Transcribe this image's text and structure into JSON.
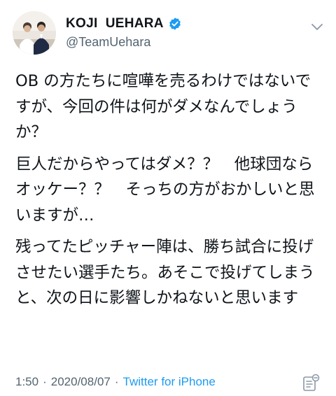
{
  "tweet": {
    "author": {
      "display_name": "KOJI  UEHARA",
      "handle": "@TeamUehara",
      "verified": true
    },
    "paragraphs": [
      "OB の方たちに喧嘩を売るわけではないですが、今回の件は何がダメなんでしょうか？",
      "巨人だからやってはダメ？？　他球団ならオッケー？？　そっちの方がおかしいと思いますが…",
      "残ってたピッチャー陣は、勝ち試合に投げさせたい選手たち。あそこで投げてしまうと、次の日に影響しかねないと思います"
    ],
    "time": "1:50",
    "date": "2020/08/07",
    "separator": "·",
    "source": "Twitter for iPhone"
  },
  "colors": {
    "text": "#0f1419",
    "secondary": "#536471",
    "accent": "#1d9bf0"
  },
  "icons": {
    "verified": "verified-badge-icon",
    "more": "chevron-down-icon",
    "analytics": "tweet-analytics-icon"
  }
}
